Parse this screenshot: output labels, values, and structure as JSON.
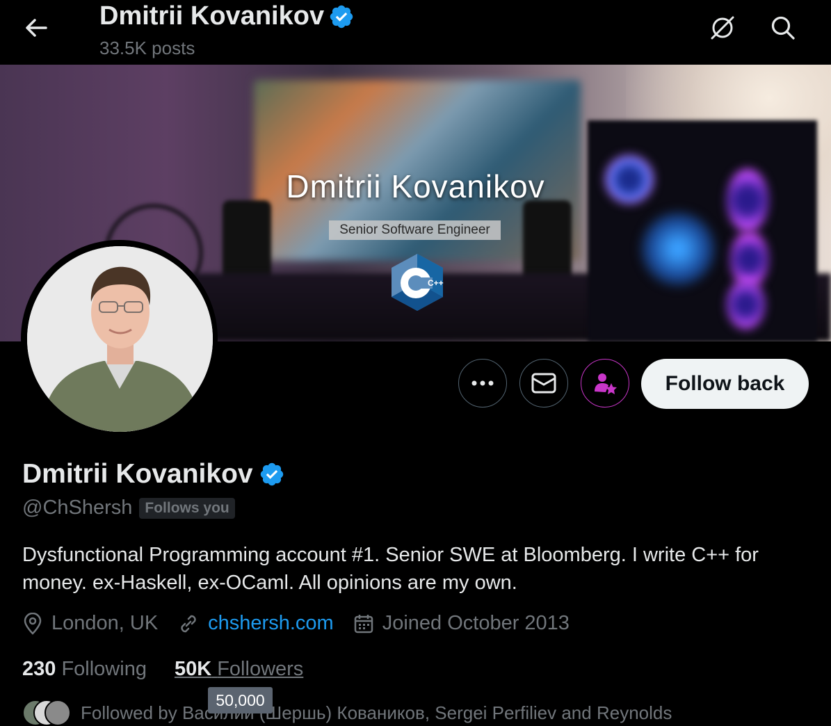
{
  "header": {
    "title": "Dmitrii Kovanikov",
    "posts": "33.5K posts"
  },
  "banner": {
    "name": "Dmitrii Kovanikov",
    "role": "Senior Software Engineer",
    "logo_text": "C++"
  },
  "actions": {
    "follow_back_label": "Follow back"
  },
  "profile": {
    "display_name": "Dmitrii Kovanikov",
    "handle": "@ChShersh",
    "follows_you": "Follows you",
    "bio": "Dysfunctional Programming account #1. Senior SWE at Bloomberg. I write C++ for money. ex-Haskell, ex-OCaml. All opinions are my own.",
    "location": "London, UK",
    "website": "chshersh.com",
    "joined": "Joined October 2013",
    "following_count": "230",
    "following_label": "Following",
    "followers_count": "50K",
    "followers_label": "Followers",
    "followed_by": "Followed by Василий (Шершь) Коваников, Sergei Perfiliev and Reynolds"
  },
  "tooltip": {
    "text": "50,000"
  },
  "colors": {
    "background": "#000000",
    "text_primary": "#e7e9ea",
    "text_secondary": "#71767b",
    "link": "#1d9bf0",
    "verified": "#1d9bf0",
    "subscribe_accent": "#c936c9",
    "follow_button_bg": "#eff3f4"
  },
  "icons": {
    "back": "arrow-left-icon",
    "grok": "slash-circle-icon",
    "search": "search-icon",
    "more": "more-horizontal-icon",
    "message": "mail-icon",
    "subscribe": "person-star-icon",
    "location": "location-pin-icon",
    "link": "link-icon",
    "calendar": "calendar-icon",
    "verified": "verified-badge-icon"
  }
}
